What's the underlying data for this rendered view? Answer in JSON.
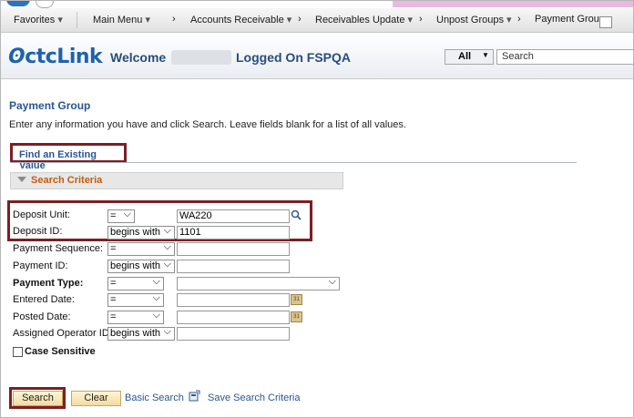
{
  "nav": {
    "favorites": "Favorites",
    "main_menu": "Main Menu",
    "accounts_receivable": "Accounts Receivable",
    "receivables_update": "Receivables Update",
    "unpost_groups": "Unpost Groups",
    "payment_group": "Payment Group"
  },
  "header": {
    "logo": "ctcLink",
    "welcome": "Welcome",
    "logged_on": "Logged On FSPQA",
    "search_scope": "All",
    "search_placeholder": "Search"
  },
  "page": {
    "title": "Payment Group",
    "instructions": "Enter any information you have and click Search. Leave fields blank for a list of all values.",
    "tab_find": "Find an Existing Value",
    "criteria_title": "Search Criteria"
  },
  "fields": [
    {
      "label": "Deposit Unit:",
      "operator": "=",
      "value": "WA220"
    },
    {
      "label": "Deposit ID:",
      "operator": "begins with",
      "value": "1101"
    },
    {
      "label": "Payment Sequence:",
      "operator": "=",
      "value": ""
    },
    {
      "label": "Payment ID:",
      "operator": "begins with",
      "value": ""
    },
    {
      "label": "Payment Type:",
      "operator": "=",
      "value": ""
    },
    {
      "label": "Entered Date:",
      "operator": "=",
      "value": ""
    },
    {
      "label": "Posted Date:",
      "operator": "=",
      "value": ""
    },
    {
      "label": "Assigned Operator ID:",
      "operator": "begins with",
      "value": ""
    }
  ],
  "case_sensitive_label": "Case Sensitive",
  "actions": {
    "search": "Search",
    "clear": "Clear",
    "basic_search": "Basic Search",
    "save_criteria": "Save Search Criteria"
  },
  "colors": {
    "title_blue": "#2a5592",
    "highlight_border": "#7c1f24",
    "criteria_orange": "#c05d11"
  }
}
